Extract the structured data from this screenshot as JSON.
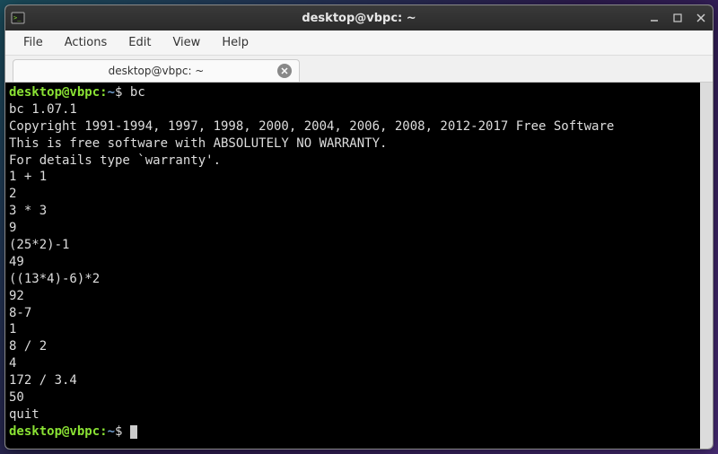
{
  "titlebar": {
    "title": "desktop@vbpc: ~"
  },
  "menubar": {
    "file": "File",
    "actions": "Actions",
    "edit": "Edit",
    "view": "View",
    "help": "Help"
  },
  "tab": {
    "label": "desktop@vbpc: ~"
  },
  "prompt": {
    "user_host": "desktop@vbpc",
    "colon": ":",
    "path": "~",
    "dollar": "$"
  },
  "terminal": {
    "cmd1": "bc",
    "l1": "bc 1.07.1",
    "l2": "Copyright 1991-1994, 1997, 1998, 2000, 2004, 2006, 2008, 2012-2017 Free Software",
    "l3": "This is free software with ABSOLUTELY NO WARRANTY.",
    "l4": "For details type `warranty'.",
    "l5": "1 + 1",
    "l6": "2",
    "l7": "3 * 3",
    "l8": "9",
    "l9": "(25*2)-1",
    "l10": "49",
    "l11": "((13*4)-6)*2",
    "l12": "92",
    "l13": "8-7",
    "l14": "1",
    "l15": "8 / 2",
    "l16": "4",
    "l17": "172 / 3.4",
    "l18": "50",
    "l19": "quit"
  }
}
